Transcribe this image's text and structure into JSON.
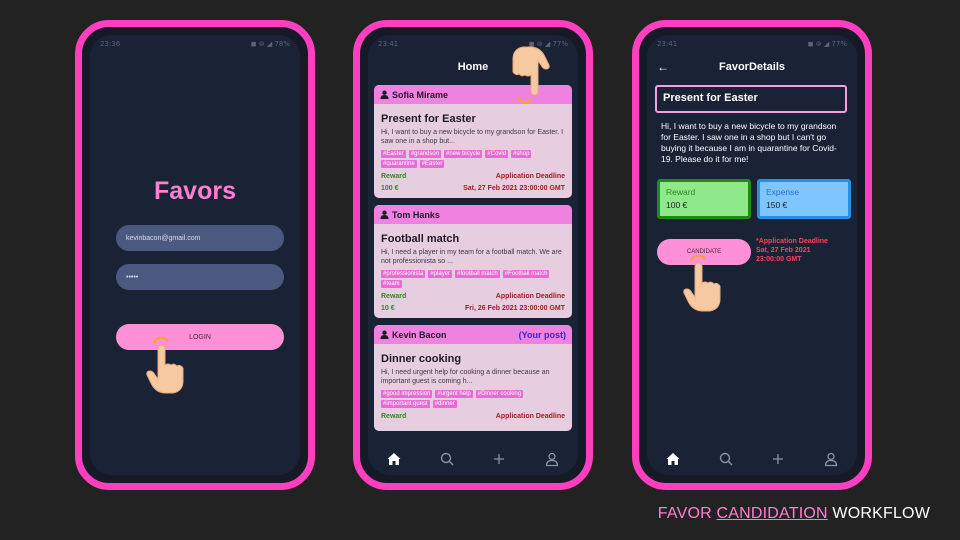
{
  "colors": {
    "frame": "#ff3fbf",
    "accent": "#ff8fd6",
    "screen_bg": "#1a2235",
    "card_bg": "#e7cde0",
    "card_header": "#ef82e0"
  },
  "login_screen": {
    "status_time": "23:36",
    "status_right": "◼ ⊚ ◢ 78%",
    "title": "Favors",
    "email_value": "kevinbacon@gmail.com",
    "password_value": "•••••",
    "login_label": "LOGIN"
  },
  "home_screen": {
    "status_time": "23:41",
    "status_right": "◼ ⊚ ◢ 77%",
    "title": "Home",
    "cards": [
      {
        "user": "Sofia Mirame",
        "badge": "",
        "title": "Present for Easter",
        "desc": "Hi, I want to buy a new bicycle to my grandson for Easter. I saw one in a shop but...",
        "tags": [
          "#Easter",
          "#grandson",
          "#new bicycle",
          "#Covid",
          "#shop",
          "#quarantine",
          "#Easter"
        ],
        "reward_label": "Reward",
        "deadline_label": "Application Deadline",
        "reward": "100 €",
        "deadline": "Sat, 27 Feb 2021 23:00:00 GMT"
      },
      {
        "user": "Tom Hanks",
        "badge": "",
        "title": "Football match",
        "desc": "Hi, I need a player in my team for a football match. We are not professionista so ...",
        "tags": [
          "#professionista",
          "#player",
          "#football match",
          "#Football match",
          "#team"
        ],
        "reward_label": "Reward",
        "deadline_label": "Application Deadline",
        "reward": "10 €",
        "deadline": "Fri, 26 Feb 2021 23:00:00 GMT"
      },
      {
        "user": "Kevin Bacon",
        "badge": "(Your post)",
        "title": "Dinner cooking",
        "desc": "Hi, I need urgent help for cooking a dinner because an important guest is coming h...",
        "tags": [
          "#good impression",
          "#urgent help",
          "#Dinner cooking",
          "#important guest",
          "#dinner"
        ],
        "reward_label": "Reward",
        "deadline_label": "Application Deadline",
        "reward": "",
        "deadline": ""
      }
    ],
    "nav": [
      "home-icon",
      "search-icon",
      "add-icon",
      "profile-icon"
    ]
  },
  "details_screen": {
    "status_time": "23:41",
    "status_right": "◼ ⊚ ◢ 77%",
    "title": "FavorDetails",
    "favor_title": "Present for Easter",
    "description": "Hi, I want to buy a new bicycle to my grandson for Easter. I saw one in a shop but I can't go buying it because I am in quarantine for Covid-19. Please do it for me!",
    "reward_label": "Reward",
    "reward_value": "100 €",
    "expense_label": "Expense",
    "expense_value": "150 €",
    "candidate_label": "CANDIDATE",
    "deadline_label": "*Application Deadline",
    "deadline_date": "Sat, 27 Feb 2021",
    "deadline_time": "23:00:00 GMT"
  },
  "caption": {
    "part1": "FAVOR",
    "part2": "CANDIDATION",
    "part3": "WORKFLOW"
  }
}
